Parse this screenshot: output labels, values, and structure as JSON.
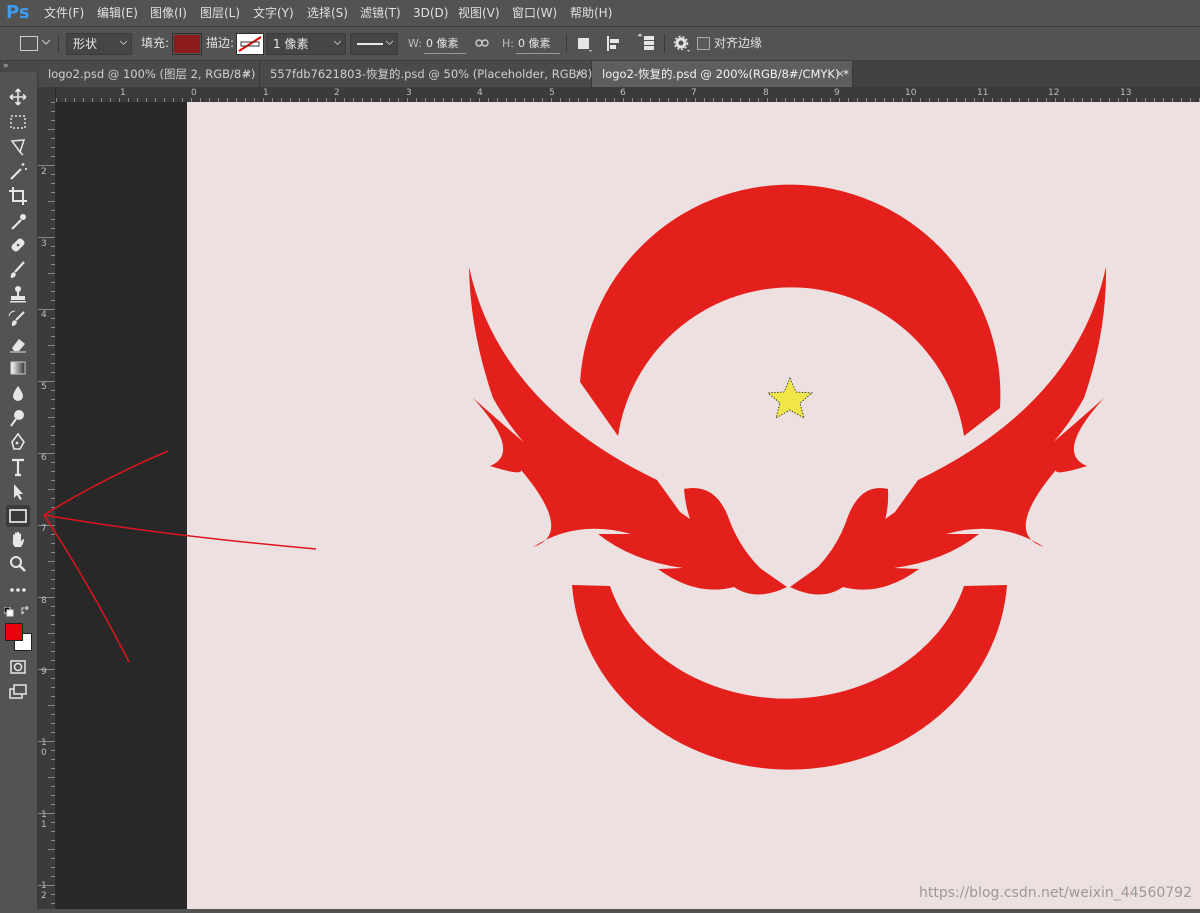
{
  "app": {
    "logo": "Ps"
  },
  "menu": [
    "文件(F)",
    "编辑(E)",
    "图像(I)",
    "图层(L)",
    "文字(Y)",
    "选择(S)",
    "滤镜(T)",
    "3D(D)",
    "视图(V)",
    "窗口(W)",
    "帮助(H)"
  ],
  "options": {
    "mode_value": "形状",
    "fill_label": "填充:",
    "fill_color": "#8b1a1a",
    "stroke_label": "描边:",
    "stroke_width": "1 像素",
    "w_label": "W:",
    "w_value": "0 像素",
    "h_label": "H:",
    "h_value": "0 像素",
    "align_edges_label": "对齐边缘"
  },
  "tabs": [
    {
      "label": "logo2.psd @ 100% (图层 2, RGB/8#)",
      "close": "×",
      "active": false
    },
    {
      "label": "557fdb7621803-恢复的.psd @ 50% (Placeholder, RGB/8) *",
      "close": "×",
      "active": false
    },
    {
      "label": "logo2-恢复的.psd @ 200%(RGB/8#/CMYK) *",
      "close": "×",
      "active": true
    }
  ],
  "ruler_h_labels": [
    "1",
    "0",
    "1",
    "2",
    "3",
    "4",
    "5",
    "6",
    "7",
    "8",
    "9",
    "10",
    "11",
    "12",
    "13"
  ],
  "ruler_v_labels": [
    "2",
    "3",
    "4",
    "5",
    "6",
    "7",
    "8",
    "9",
    "1 0",
    "1 1",
    "1 2"
  ],
  "colors": {
    "foreground": "#e8000b",
    "background": "#ffffff",
    "logo_red": "#e4201c",
    "star": "#f0e64a",
    "annotation": "#e0141e",
    "canvas": "#ede0e0"
  },
  "watermark": "https://blog.csdn.net/weixin_44560792"
}
